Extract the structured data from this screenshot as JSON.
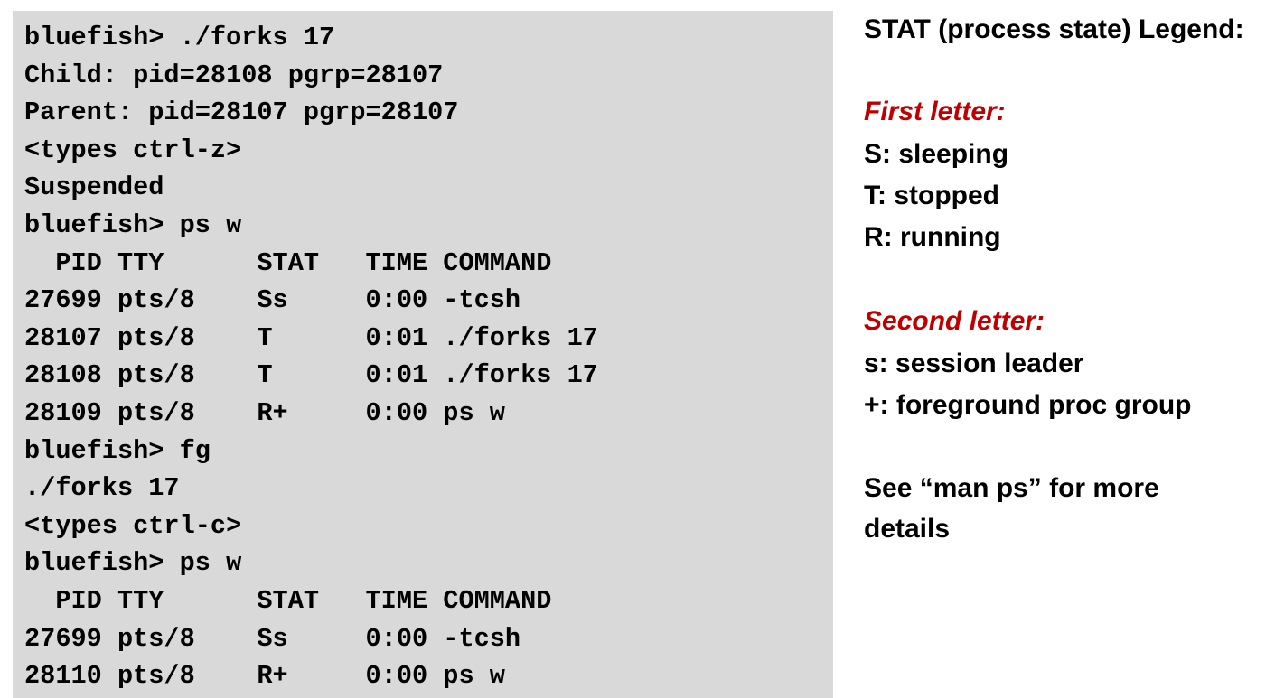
{
  "terminal": {
    "lines": [
      "bluefish> ./forks 17",
      "Child: pid=28108 pgrp=28107",
      "Parent: pid=28107 pgrp=28107",
      "<types ctrl-z>",
      "Suspended",
      "bluefish> ps w",
      "  PID TTY      STAT   TIME COMMAND",
      "27699 pts/8    Ss     0:00 -tcsh",
      "28107 pts/8    T      0:01 ./forks 17",
      "28108 pts/8    T      0:01 ./forks 17",
      "28109 pts/8    R+     0:00 ps w",
      "bluefish> fg",
      "./forks 17",
      "<types ctrl-c>",
      "bluefish> ps w",
      "  PID TTY      STAT   TIME COMMAND",
      "27699 pts/8    Ss     0:00 -tcsh",
      "28110 pts/8    R+     0:00 ps w"
    ]
  },
  "legend": {
    "title": "STAT (process state) Legend:",
    "first_heading": "First letter:",
    "first_items": [
      "S: sleeping",
      "T: stopped",
      "R: running"
    ],
    "second_heading": "Second letter:",
    "second_items": [
      "s: session leader",
      "+: foreground proc group"
    ],
    "see_more": "See “man ps” for more details"
  },
  "colors": {
    "terminal_background": "#d9d9d9",
    "heading_red": "#c00000",
    "text": "#000000"
  }
}
